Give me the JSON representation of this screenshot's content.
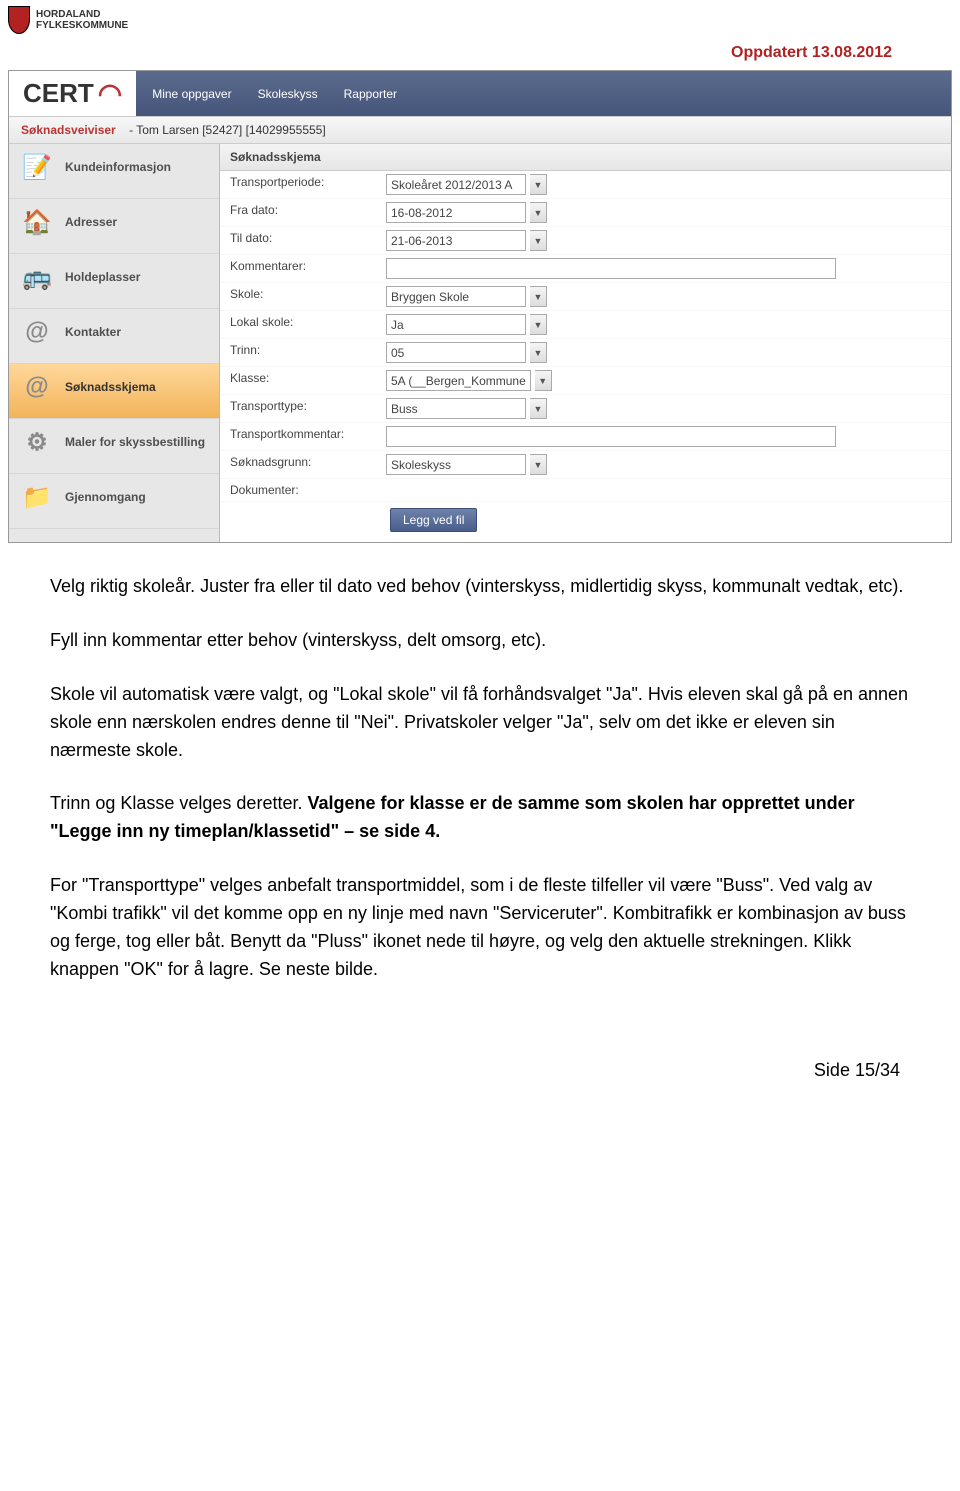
{
  "header": {
    "org_line1": "HORDALAND",
    "org_line2": "FYLKESKOMMUNE",
    "updated": "Oppdatert 13.08.2012"
  },
  "app": {
    "logo": "CERT",
    "nav": {
      "item1": "Mine oppgaver",
      "item2": "Skoleskyss",
      "item3": "Rapporter"
    },
    "breadcrumb_label": "Søknadsveiviser",
    "breadcrumb_user": "- Tom Larsen [52427] [14029955555]"
  },
  "sidebar": {
    "i1": "Kundeinformasjon",
    "i2": "Adresser",
    "i3": "Holdeplasser",
    "i4": "Kontakter",
    "i5": "Søknadsskjema",
    "i6": "Maler for skyssbestilling",
    "i7": "Gjennomgang"
  },
  "panel": {
    "title": "Søknadsskjema",
    "labels": {
      "transportperiode": "Transportperiode:",
      "fra_dato": "Fra dato:",
      "til_dato": "Til dato:",
      "kommentarer": "Kommentarer:",
      "skole": "Skole:",
      "lokal_skole": "Lokal skole:",
      "trinn": "Trinn:",
      "klasse": "Klasse:",
      "transporttype": "Transporttype:",
      "transportkommentar": "Transportkommentar:",
      "soknadsgrunn": "Søknadsgrunn:",
      "dokumenter": "Dokumenter:"
    },
    "values": {
      "transportperiode": "Skoleåret 2012/2013 A",
      "fra_dato": "16-08-2012",
      "til_dato": "21-06-2013",
      "kommentarer": "",
      "skole": "Bryggen Skole",
      "lokal_skole": "Ja",
      "trinn": "05",
      "klasse": "5A (__Bergen_Kommune",
      "transporttype": "Buss",
      "transportkommentar": "",
      "soknadsgrunn": "Skoleskyss"
    },
    "attach_btn": "Legg ved fil"
  },
  "doc": {
    "p1": "Velg riktig skoleår. Juster fra eller til dato ved behov (vinterskyss, midlertidig skyss, kommunalt vedtak, etc).",
    "p2": "Fyll inn kommentar etter behov (vinterskyss, delt omsorg, etc).",
    "p3": "Skole vil automatisk være valgt, og \"Lokal skole\" vil få forhåndsvalget \"Ja\". Hvis eleven skal gå på en annen skole enn nærskolen endres denne til \"Nei\". Privatskoler velger \"Ja\", selv om det ikke er eleven sin nærmeste skole.",
    "p4a": "Trinn og Klasse velges deretter. ",
    "p4b": "Valgene for klasse er de samme som skolen har opprettet under \"Legge inn ny timeplan/klassetid\" – se side 4.",
    "p5": "For \"Transporttype\" velges anbefalt transportmiddel, som i de fleste tilfeller vil være \"Buss\". Ved valg av \"Kombi trafikk\" vil det komme opp en ny linje med navn \"Serviceruter\". Kombitrafikk er kombinasjon av buss og ferge, tog eller båt. Benytt da \"Pluss\" ikonet nede til høyre, og velg den aktuelle strekningen. Klikk knappen \"OK\" for å lagre. Se neste bilde."
  },
  "footer": {
    "page": "Side 15/34"
  }
}
